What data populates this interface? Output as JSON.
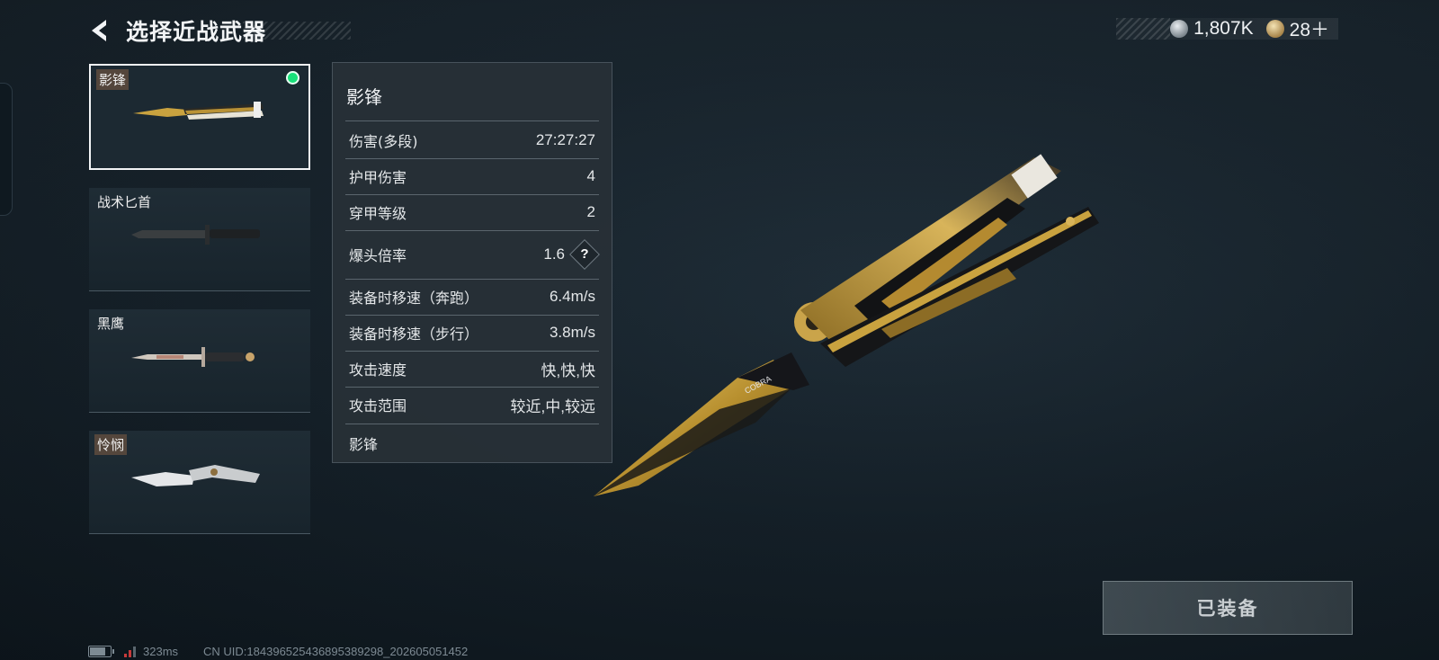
{
  "header": {
    "title": "选择近战武器"
  },
  "currency": [
    {
      "icon": "silver-coin-icon",
      "value": "1,807K"
    },
    {
      "icon": "gold-coin-icon",
      "value": "28＋"
    }
  ],
  "weapons": [
    {
      "name": "影锋",
      "selected": true,
      "equipped": true
    },
    {
      "name": "战术匕首",
      "selected": false
    },
    {
      "name": "黑鹰",
      "selected": false
    },
    {
      "name": "怜悯",
      "selected": false
    }
  ],
  "stats": {
    "title": "影锋",
    "rows": [
      {
        "label": "伤害(多段)",
        "value": "27:27:27"
      },
      {
        "label": "护甲伤害",
        "value": "4"
      },
      {
        "label": "穿甲等级",
        "value": "2"
      },
      {
        "label": "爆头倍率",
        "value": "1.6",
        "help": "?"
      },
      {
        "label": "装备时移速（奔跑）",
        "value": "6.4m/s"
      },
      {
        "label": "装备时移速（步行）",
        "value": "3.8m/s"
      },
      {
        "label": "攻击速度",
        "value": "快,快,快"
      },
      {
        "label": "攻击范围",
        "value": "较近,中,较远"
      }
    ],
    "footer": "影锋"
  },
  "equip_button": {
    "label": "已装备"
  },
  "status": {
    "ping": "323ms",
    "uid": "CN UID:184396525436895389298_202605051452"
  },
  "knife_engraving": "COBRA",
  "colors": {
    "accent_selected": "#19e07a",
    "gold": "#c9a23f"
  }
}
